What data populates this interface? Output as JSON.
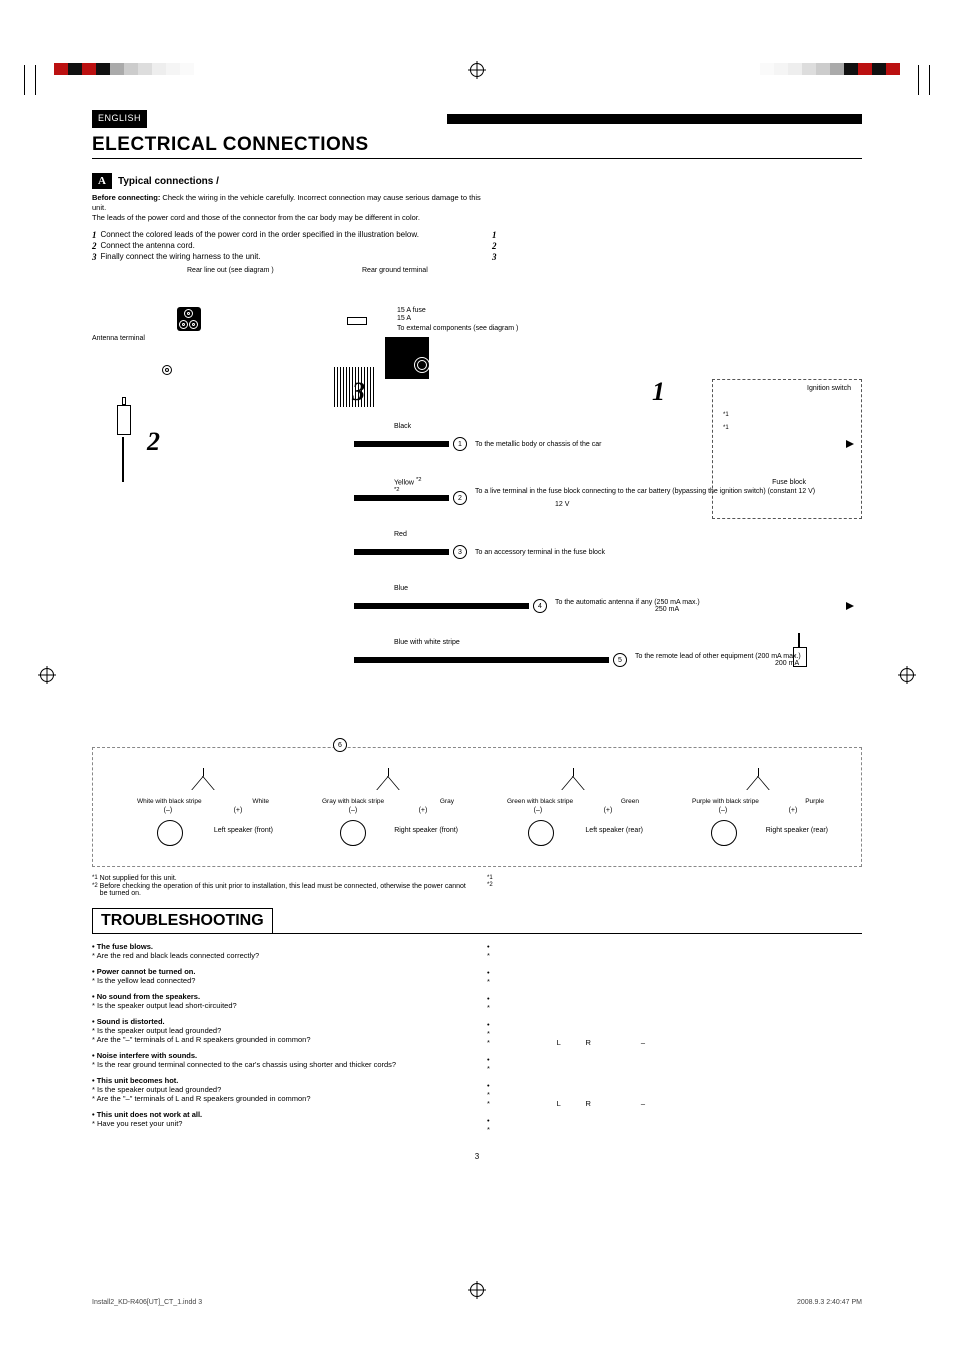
{
  "language_label": "ENGLISH",
  "main_title": "ELECTRICAL CONNECTIONS",
  "section": {
    "badge": "A",
    "title": "Typical connections /"
  },
  "intro": {
    "bold": "Before connecting:",
    "text1": " Check the wiring in the vehicle carefully. Incorrect connection may cause serious damage to this unit.",
    "text2": "The leads of the power cord and those of the connector from the car body may be different in color."
  },
  "steps_left": [
    {
      "n": "1",
      "t": "Connect the colored leads of the power cord in the order specified in the illustration below."
    },
    {
      "n": "2",
      "t": "Connect the antenna cord."
    },
    {
      "n": "3",
      "t": "Finally connect the wiring harness to the unit."
    }
  ],
  "steps_right": [
    {
      "n": "1",
      "t": ""
    },
    {
      "n": "2",
      "t": ""
    },
    {
      "n": "3",
      "t": ""
    }
  ],
  "diagram": {
    "rear_line_out": "Rear line out (see diagram  )",
    "rear_ground": "Rear ground terminal",
    "antenna_terminal": "Antenna terminal",
    "fuse_15a_1": "15 A fuse",
    "fuse_15a_2": "15 A",
    "to_external": "To external components (see diagram  )",
    "ignition_switch": "Ignition switch",
    "fuse_block": "Fuse block",
    "wires": [
      {
        "num": "1",
        "color": "Black",
        "note": "",
        "desc": "To the metallic body or chassis of the car"
      },
      {
        "num": "2",
        "color": "Yellow",
        "note": "*2",
        "note2": "*2",
        "desc": "To a live terminal in the fuse block connecting to the car battery (bypassing the ignition switch) (constant 12 V)",
        "sub": "12 V"
      },
      {
        "num": "3",
        "color": "Red",
        "note": "",
        "desc": "To an accessory terminal in the fuse block"
      },
      {
        "num": "4",
        "color": "Blue",
        "note": "",
        "desc": "To the automatic antenna if any (250 mA max.)",
        "sub": "250 mA"
      },
      {
        "num": "5",
        "color": "Blue with white stripe",
        "note": "",
        "desc": "To the remote lead of other equipment (200 mA max.)",
        "sub": "200 mA"
      }
    ],
    "circ6": "6",
    "speakers": [
      {
        "stripe": "White with black stripe",
        "solid": "White",
        "name": "Left speaker (front)"
      },
      {
        "stripe": "Gray with black stripe",
        "solid": "Gray",
        "name": "Right speaker (front)"
      },
      {
        "stripe": "Green with black stripe",
        "solid": "Green",
        "name": "Left speaker (rear)"
      },
      {
        "stripe": "Purple with black stripe",
        "solid": "Purple",
        "name": "Right speaker (rear)"
      }
    ],
    "minus": "(–)",
    "plus": "(+)",
    "star1": "*1"
  },
  "footnotes_left": [
    {
      "sup": "*1",
      "t": "Not supplied for this unit."
    },
    {
      "sup": "*2",
      "t": "Before checking the operation of this unit prior to installation, this lead must be connected, otherwise the power cannot be turned on."
    }
  ],
  "footnotes_right": [
    {
      "sup": "*1",
      "t": ""
    },
    {
      "sup": "*2",
      "t": ""
    }
  ],
  "troubleshooting_title": "TROUBLESHOOTING",
  "trouble_left": [
    {
      "h": "The fuse blows.",
      "q": [
        "Are the red and black leads connected correctly?"
      ]
    },
    {
      "h": "Power cannot be turned on.",
      "q": [
        "Is the yellow lead connected?"
      ]
    },
    {
      "h": "No sound from the speakers.",
      "q": [
        "Is the speaker output lead short-circuited?"
      ]
    },
    {
      "h": "Sound is distorted.",
      "q": [
        "Is the speaker output lead grounded?",
        "Are the \"–\" terminals of L and R speakers grounded in common?"
      ]
    },
    {
      "h": "Noise interfere with sounds.",
      "q": [
        "Is the rear ground terminal connected to the car's chassis using shorter and thicker cords?"
      ]
    },
    {
      "h": "This unit becomes hot.",
      "q": [
        "Is the speaker output lead grounded?",
        "Are the \"–\" terminals of L and R speakers grounded in common?"
      ]
    },
    {
      "h": "This unit does not work at all.",
      "q": [
        "Have you reset your unit?"
      ]
    }
  ],
  "trouble_right": [
    {
      "b": "",
      "s": ""
    },
    {
      "b": "",
      "s": ""
    },
    {
      "b": "",
      "s": ""
    },
    {
      "b": "",
      "s": "",
      "s2": "                                L            R                        –"
    },
    {
      "b": "",
      "s": ""
    },
    {
      "b": "",
      "s": "",
      "s2": "                                L            R                        –"
    },
    {
      "b": "",
      "s": ""
    }
  ],
  "page_number": "3",
  "footer_left": "Install2_KD-R406[UT]_CT_1.indd   3",
  "footer_right": "2008.9.3   2:40:47 PM"
}
